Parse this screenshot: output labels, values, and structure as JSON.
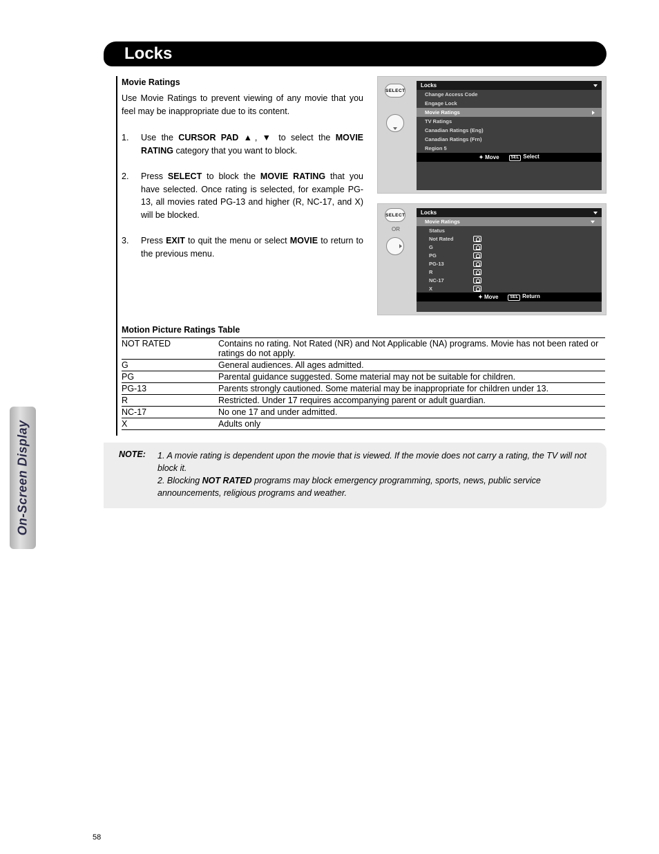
{
  "side_tab": "On-Screen Display",
  "page_number": "58",
  "header_title": "Locks",
  "sub_head": "Movie Ratings",
  "intro": "Use Movie Ratings to prevent viewing of any movie that you feel may be inappropriate due to its content.",
  "steps": {
    "s1": {
      "num": "1.",
      "pre": "Use the ",
      "b1": "CURSOR PAD",
      "mid": " ▲, ▼ to select the ",
      "b2": "MOVIE RATING",
      "post": " category that you want to block."
    },
    "s2": {
      "num": "2.",
      "pre": "Press ",
      "b1": "SELECT",
      "mid": " to block the ",
      "b2": "MOVIE RATING",
      "post": " that you have selected. Once rating is selected, for example PG-13, all movies rated PG-13 and higher (R, NC-17, and X) will be blocked."
    },
    "s3": {
      "num": "3.",
      "pre": "Press ",
      "b1": "EXIT",
      "mid": " to quit the menu or select ",
      "b2": "MOVIE",
      "post": " to return to the previous menu."
    }
  },
  "remote": {
    "select": "SELECT",
    "or": "OR"
  },
  "osd1": {
    "title": "Locks",
    "items": [
      "Change Access Code",
      "Engage Lock",
      "Movie Ratings",
      "TV Ratings",
      "Canadian Ratings (Eng)",
      "Canadian Ratings (Frn)",
      "Region 5"
    ],
    "selected_index": 2,
    "move": "Move",
    "sel": "SEL",
    "select": "Select"
  },
  "osd2": {
    "title": "Locks",
    "sub": "Movie Ratings",
    "status": "Status",
    "rows": [
      "Not Rated",
      "G",
      "PG",
      "PG-13",
      "R",
      "NC-17",
      "X"
    ],
    "move": "Move",
    "sel": "SEL",
    "return": "Return"
  },
  "table_head": "Motion Picture Ratings Table",
  "ratings": [
    {
      "code": "NOT RATED",
      "desc": "Contains no rating. Not Rated (NR) and Not Applicable (NA) programs. Movie has not been rated or ratings do not apply."
    },
    {
      "code": "G",
      "desc": "General audiences. All ages admitted."
    },
    {
      "code": "PG",
      "desc": "Parental guidance suggested. Some material may not be suitable for children."
    },
    {
      "code": "PG-13",
      "desc": "Parents strongly cautioned. Some material may be inappropriate for children under 13."
    },
    {
      "code": "R",
      "desc": "Restricted. Under 17 requires accompanying parent or adult guardian."
    },
    {
      "code": "NC-17",
      "desc": "No one 17 and under admitted."
    },
    {
      "code": "X",
      "desc": "Adults only"
    }
  ],
  "note": {
    "label": "NOTE:",
    "n1_num": "1.",
    "n1": "A movie rating is dependent upon the movie that is viewed. If the movie does not carry a rating, the TV will not block it.",
    "n2_num": "2.",
    "n2_pre": "Blocking ",
    "n2_b": "NOT RATED",
    "n2_post": " programs may block emergency programming, sports, news, public service announcements, religious programs and weather."
  }
}
